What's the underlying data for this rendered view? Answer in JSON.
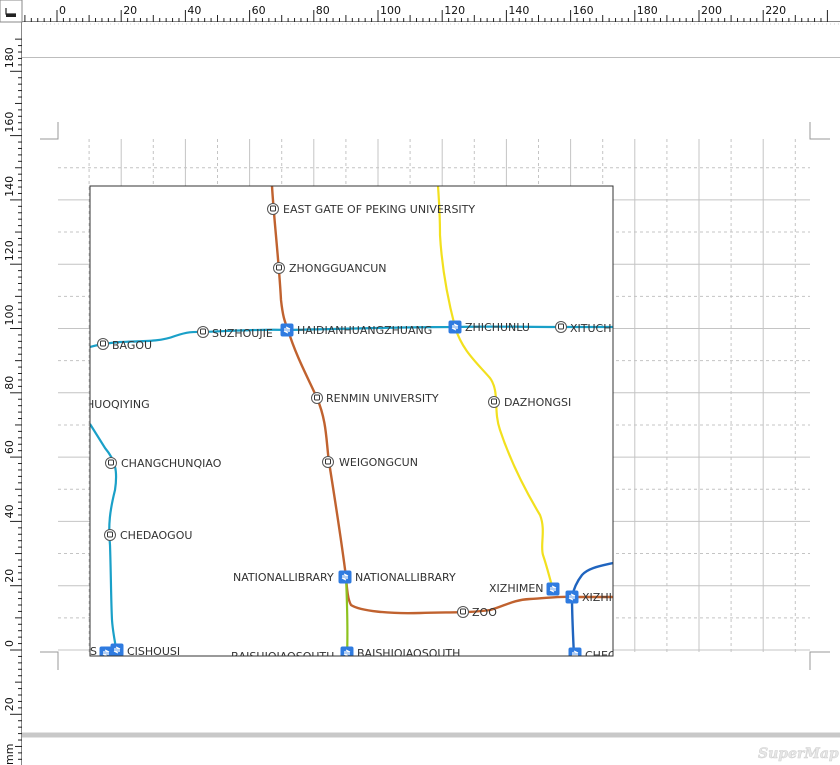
{
  "rulers": {
    "horizontal_ticks": [
      "0",
      "20",
      "40",
      "60",
      "80",
      "100",
      "120",
      "140",
      "160",
      "180",
      "200",
      "220"
    ],
    "vertical_ticks": [
      "180",
      "160",
      "140",
      "120",
      "100",
      "80",
      "60",
      "40",
      "20",
      "0",
      "20"
    ],
    "vertical_unit": "mm"
  },
  "map": {
    "station_labels": {
      "east_gate": "EAST GATE OF PEKING UNIVERSITY",
      "zhongguancun": "ZHONGGUANCUN",
      "suzhoujie": "SUZHOUJIE",
      "bagou": "BAGOU",
      "haidianhuangzhuang": "HAIDIANHUANGZHUANG",
      "zhichunlu": "ZHICHUNLU",
      "xituchi": "XITUCHI",
      "huoqiying": "HUOQIYING",
      "renmin_university": "RENMIN UNIVERSITY",
      "dazhongsi": "DAZHONGSI",
      "changchunqiao": "CHANGCHUNQIAO",
      "weigongcun": "WEIGONGCUN",
      "chedaogou": "CHEDAOGOU",
      "nationallibrary_left": "NATIONALLIBRARY",
      "nationallibrary_right": "NATIONALLIBRARY",
      "xizhimen": "XIZHIMEN",
      "xizhimen_right": "XIZHIMEN",
      "zoo": "ZOO",
      "cishousi": "CISHOUSI",
      "cishousi_left": "S",
      "baishiqiaosouth_left": "BAISHIQIAOSOUTH",
      "baishiqiaosouth_right": "BAISHIQIAOSOUTH",
      "chegongzhuang": "CHEGONGZHUANG"
    },
    "line_colors": {
      "line4_brown": "#c0622f",
      "line13_yellow": "#f2e01e",
      "line10_cyan": "#1aa0c8",
      "line2_blue": "#1f64bf",
      "line9_green": "#8dc21f"
    }
  },
  "watermark": "SuperMap",
  "icons": {
    "station": "bus-circle-icon",
    "transfer": "transfer-square-icon",
    "ruler_corner": "ruler-origin-icon"
  }
}
